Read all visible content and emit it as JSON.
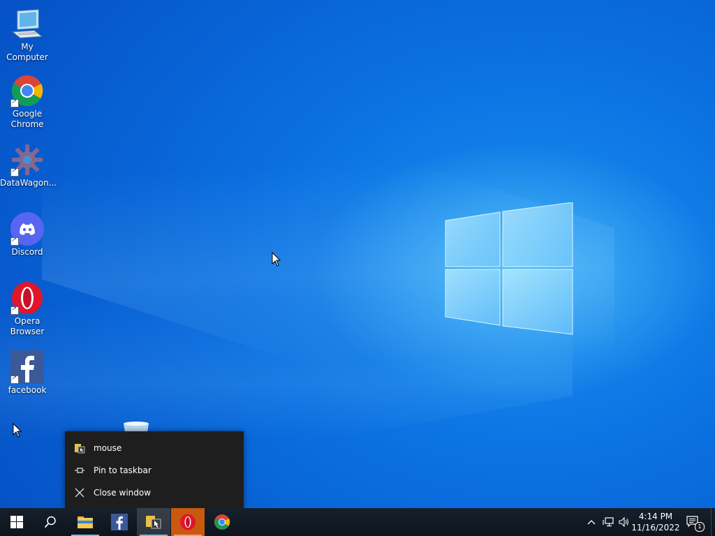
{
  "desktop": {
    "icons": [
      {
        "label": "My Computer",
        "icon": "computer-icon"
      },
      {
        "label": "Google Chrome",
        "icon": "chrome-icon"
      },
      {
        "label": "DataWagon...",
        "icon": "datawagon-icon"
      },
      {
        "label": "Discord",
        "icon": "discord-icon"
      },
      {
        "label": "Opera Browser",
        "icon": "opera-icon"
      },
      {
        "label": "facebook",
        "icon": "facebook-icon"
      }
    ]
  },
  "jumplist": {
    "app_label": "mouse",
    "pin_label": "Pin to taskbar",
    "close_label": "Close window"
  },
  "taskbar": {
    "items": [
      "start-icon",
      "search-icon",
      "file-explorer-icon",
      "facebook-icon",
      "mouse-app-icon",
      "opera-icon",
      "chrome-icon"
    ],
    "clock_time": "4:14 PM",
    "clock_date": "11/16/2022",
    "notification_count": "1"
  },
  "colors": {
    "taskbar_bg": "#101823",
    "accent": "#76b9ed",
    "jumplist_bg": "#1e1e1e"
  }
}
